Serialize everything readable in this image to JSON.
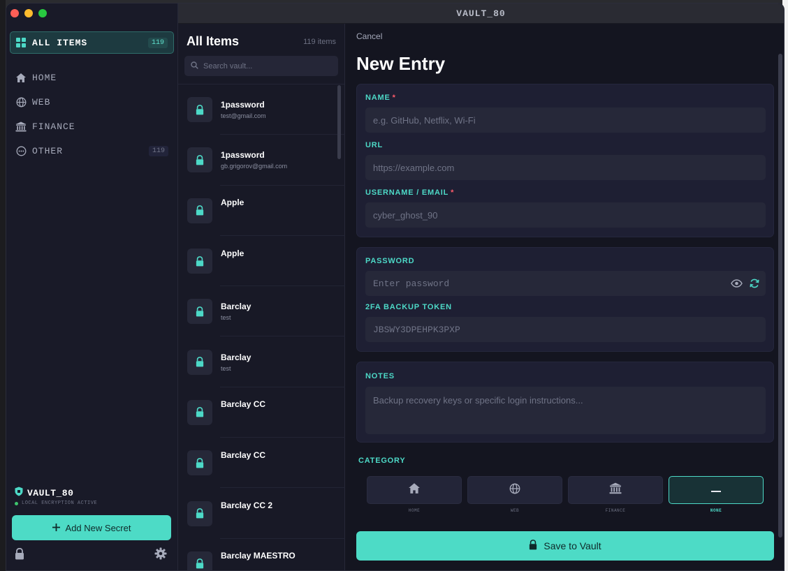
{
  "app": {
    "title": "VAULT_80"
  },
  "colors": {
    "accent": "#4dd9c7",
    "required": "#ff5b6b",
    "status_ok": "#3ec46d"
  },
  "sidebar": {
    "all_items": {
      "label": "ALL ITEMS",
      "count": "119",
      "icon": "grid-icon"
    },
    "items": [
      {
        "label": "HOME",
        "icon": "home-icon",
        "count": ""
      },
      {
        "label": "WEB",
        "icon": "globe-icon",
        "count": ""
      },
      {
        "label": "FINANCE",
        "icon": "bank-icon",
        "count": ""
      },
      {
        "label": "OTHER",
        "icon": "dots-circle-icon",
        "count": "119"
      }
    ],
    "vault_name": "VAULT_80",
    "encryption_status": "LOCAL ENCRYPTION ACTIVE",
    "add_button": "Add New Secret"
  },
  "list": {
    "title": "All Items",
    "count": "119 items",
    "search_placeholder": "Search vault...",
    "rows": [
      {
        "title": "1password",
        "subtitle": "test@gmail.com"
      },
      {
        "title": "1password",
        "subtitle": "gb.grigorov@gmail.com"
      },
      {
        "title": "Apple",
        "subtitle": ""
      },
      {
        "title": "Apple",
        "subtitle": ""
      },
      {
        "title": "Barclay",
        "subtitle": "test"
      },
      {
        "title": "Barclay",
        "subtitle": "test"
      },
      {
        "title": "Barclay CC",
        "subtitle": ""
      },
      {
        "title": "Barclay CC",
        "subtitle": ""
      },
      {
        "title": "Barclay CC 2",
        "subtitle": ""
      },
      {
        "title": "Barclay MAESTRO",
        "subtitle": ""
      }
    ]
  },
  "form": {
    "cancel": "Cancel",
    "heading": "New Entry",
    "name": {
      "label": "NAME",
      "required": "*",
      "placeholder": "e.g. GitHub, Netflix, Wi-Fi"
    },
    "url": {
      "label": "URL",
      "placeholder": "https://example.com"
    },
    "username": {
      "label": "USERNAME / EMAIL",
      "required": "*",
      "placeholder": "cyber_ghost_90"
    },
    "password": {
      "label": "PASSWORD",
      "placeholder": "Enter password"
    },
    "token": {
      "label": "2FA BACKUP TOKEN",
      "placeholder": "JBSWY3DPEHPK3PXP"
    },
    "notes": {
      "label": "NOTES",
      "placeholder": "Backup recovery keys or specific login instructions..."
    },
    "category": {
      "label": "CATEGORY",
      "options": [
        {
          "label": "HOME",
          "icon": "home-icon"
        },
        {
          "label": "WEB",
          "icon": "globe-icon"
        },
        {
          "label": "FINANCE",
          "icon": "bank-icon"
        },
        {
          "label": "NONE",
          "icon": "minus-icon",
          "selected": true
        }
      ]
    },
    "save": "Save to Vault"
  }
}
